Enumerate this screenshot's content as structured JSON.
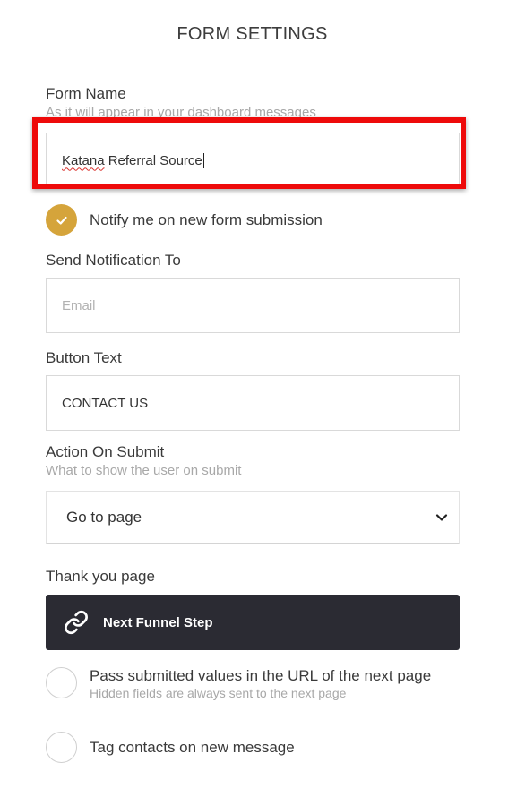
{
  "header": {
    "title": "FORM SETTINGS"
  },
  "form_name": {
    "label": "Form Name",
    "hint": "As it will appear in your dashboard messages",
    "value_word1": "Katana",
    "value_rest": " Referral Source"
  },
  "notify": {
    "label": "Notify me on new form submission",
    "checked": true
  },
  "send_notification": {
    "label": "Send Notification To",
    "placeholder": "Email"
  },
  "button_text": {
    "label": "Button Text",
    "value": "CONTACT US"
  },
  "action_on_submit": {
    "label": "Action On Submit",
    "hint": "What to show the user on submit",
    "selected": "Go to page"
  },
  "thank_you": {
    "label": "Thank you page",
    "button_label": "Next Funnel Step"
  },
  "pass_values": {
    "label": "Pass submitted values in the URL of the next page",
    "hint": "Hidden fields are always sent to the next page",
    "checked": false
  },
  "tag_contacts": {
    "label": "Tag contacts on new message",
    "checked": false
  },
  "colors": {
    "accent": "#d5a43b",
    "highlight": "#ee0a0a",
    "dark_button": "#2b2b33"
  }
}
